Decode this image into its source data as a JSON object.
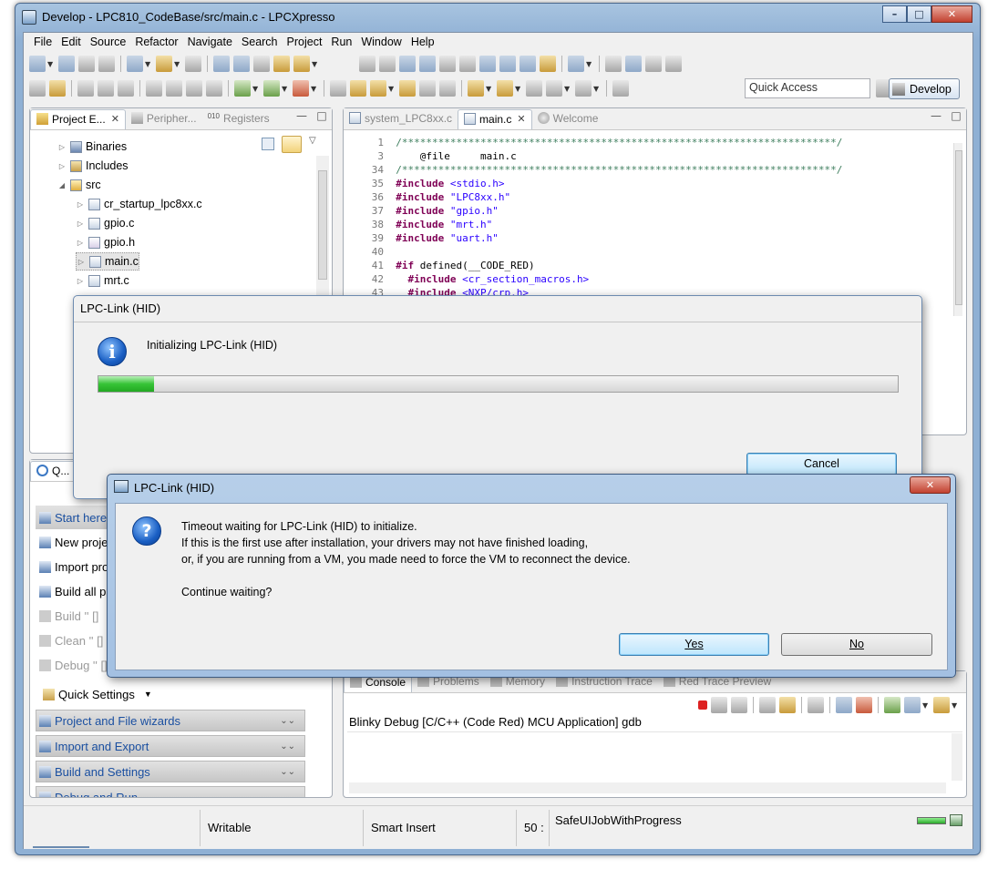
{
  "window": {
    "title": "Develop - LPC810_CodeBase/src/main.c - LPCXpresso"
  },
  "menubar": [
    "File",
    "Edit",
    "Source",
    "Refactor",
    "Navigate",
    "Search",
    "Project",
    "Run",
    "Window",
    "Help"
  ],
  "toolbar": {
    "quick_access_placeholder": "Quick Access",
    "perspective_label": "Develop"
  },
  "left_panel": {
    "tabs": [
      {
        "label": "Project E...",
        "active": true
      },
      {
        "label": "Peripher...",
        "active": false
      },
      {
        "label": "Registers",
        "active": false
      }
    ],
    "tree": [
      {
        "label": "Binaries",
        "level": 1,
        "expanded": false,
        "icon": "binaries-icon"
      },
      {
        "label": "Includes",
        "level": 1,
        "expanded": false,
        "icon": "includes-icon"
      },
      {
        "label": "src",
        "level": 1,
        "expanded": true,
        "icon": "folder-icon"
      },
      {
        "label": "cr_startup_lpc8xx.c",
        "level": 2,
        "expanded": false,
        "icon": "c-file-icon"
      },
      {
        "label": "gpio.c",
        "level": 2,
        "expanded": false,
        "icon": "c-file-icon"
      },
      {
        "label": "gpio.h",
        "level": 2,
        "expanded": false,
        "icon": "h-file-icon"
      },
      {
        "label": "main.c",
        "level": 2,
        "expanded": false,
        "icon": "c-file-icon",
        "selected": true
      },
      {
        "label": "mrt.c",
        "level": 2,
        "expanded": false,
        "icon": "c-file-icon"
      }
    ]
  },
  "editor": {
    "tabs": [
      {
        "label": "system_LPC8xx.c",
        "active": false
      },
      {
        "label": "main.c",
        "active": true
      },
      {
        "label": "Welcome",
        "active": false
      }
    ],
    "lines": [
      {
        "n": "1",
        "text": "/************************************************************************/"
      },
      {
        "n": "3",
        "text": "    @file     main.c"
      },
      {
        "n": "34",
        "text": "/************************************************************************/"
      },
      {
        "n": "35",
        "kw": "#include",
        "arg": "<stdio.h>"
      },
      {
        "n": "36",
        "kw": "#include",
        "arg": "\"LPC8xx.h\""
      },
      {
        "n": "37",
        "kw": "#include",
        "arg": "\"gpio.h\""
      },
      {
        "n": "38",
        "kw": "#include",
        "arg": "\"mrt.h\""
      },
      {
        "n": "39",
        "kw": "#include",
        "arg": "\"uart.h\""
      },
      {
        "n": "40",
        "text": ""
      },
      {
        "n": "41",
        "kw": "#if",
        "text": " defined(__CODE_RED)"
      },
      {
        "n": "42",
        "kw": "  #include",
        "arg": "<cr_section_macros.h>"
      },
      {
        "n": "43",
        "kw": "  #include",
        "arg": "<NXP/crp.h>"
      }
    ]
  },
  "quick_start": {
    "tab_label": "Q...",
    "items": [
      {
        "label": "Start here",
        "enabled": true,
        "highlight": true
      },
      {
        "label": "New project...",
        "enabled": true
      },
      {
        "label": "Import project(s)",
        "enabled": true
      },
      {
        "label": "Build all projects",
        "enabled": true
      },
      {
        "label": "Build '' []",
        "enabled": false
      },
      {
        "label": "Clean '' []",
        "enabled": false
      },
      {
        "label": "Debug '' []",
        "enabled": false
      }
    ],
    "quick_settings": "Quick Settings",
    "sections": [
      "Project and File wizards",
      "Import and Export",
      "Build and Settings",
      "Debug and Run"
    ]
  },
  "console": {
    "tabs": [
      "Console",
      "Problems",
      "Memory",
      "Instruction Trace",
      "Red Trace Preview"
    ],
    "header": "Blinky Debug [C/C++ (Code Red) MCU Application] gdb"
  },
  "progress_dialog": {
    "title": "LPC-Link (HID)",
    "message": "Initializing LPC-Link (HID)",
    "progress": 0.07,
    "cancel_label": "Cancel"
  },
  "question_dialog": {
    "title": "LPC-Link (HID)",
    "message_lines": [
      "Timeout waiting for LPC-Link (HID) to initialize.",
      "If this is the first use after installation, your drivers may not have finished loading,",
      "or, if you are running from a VM, you made need to force the VM to reconnect the device."
    ],
    "prompt": "Continue waiting?",
    "yes_label": "Yes",
    "no_label": "No"
  },
  "statusbar": {
    "writable": "Writable",
    "insert_mode": "Smart Insert",
    "position": "50 :",
    "job": "SafeUIJobWithProgress"
  }
}
